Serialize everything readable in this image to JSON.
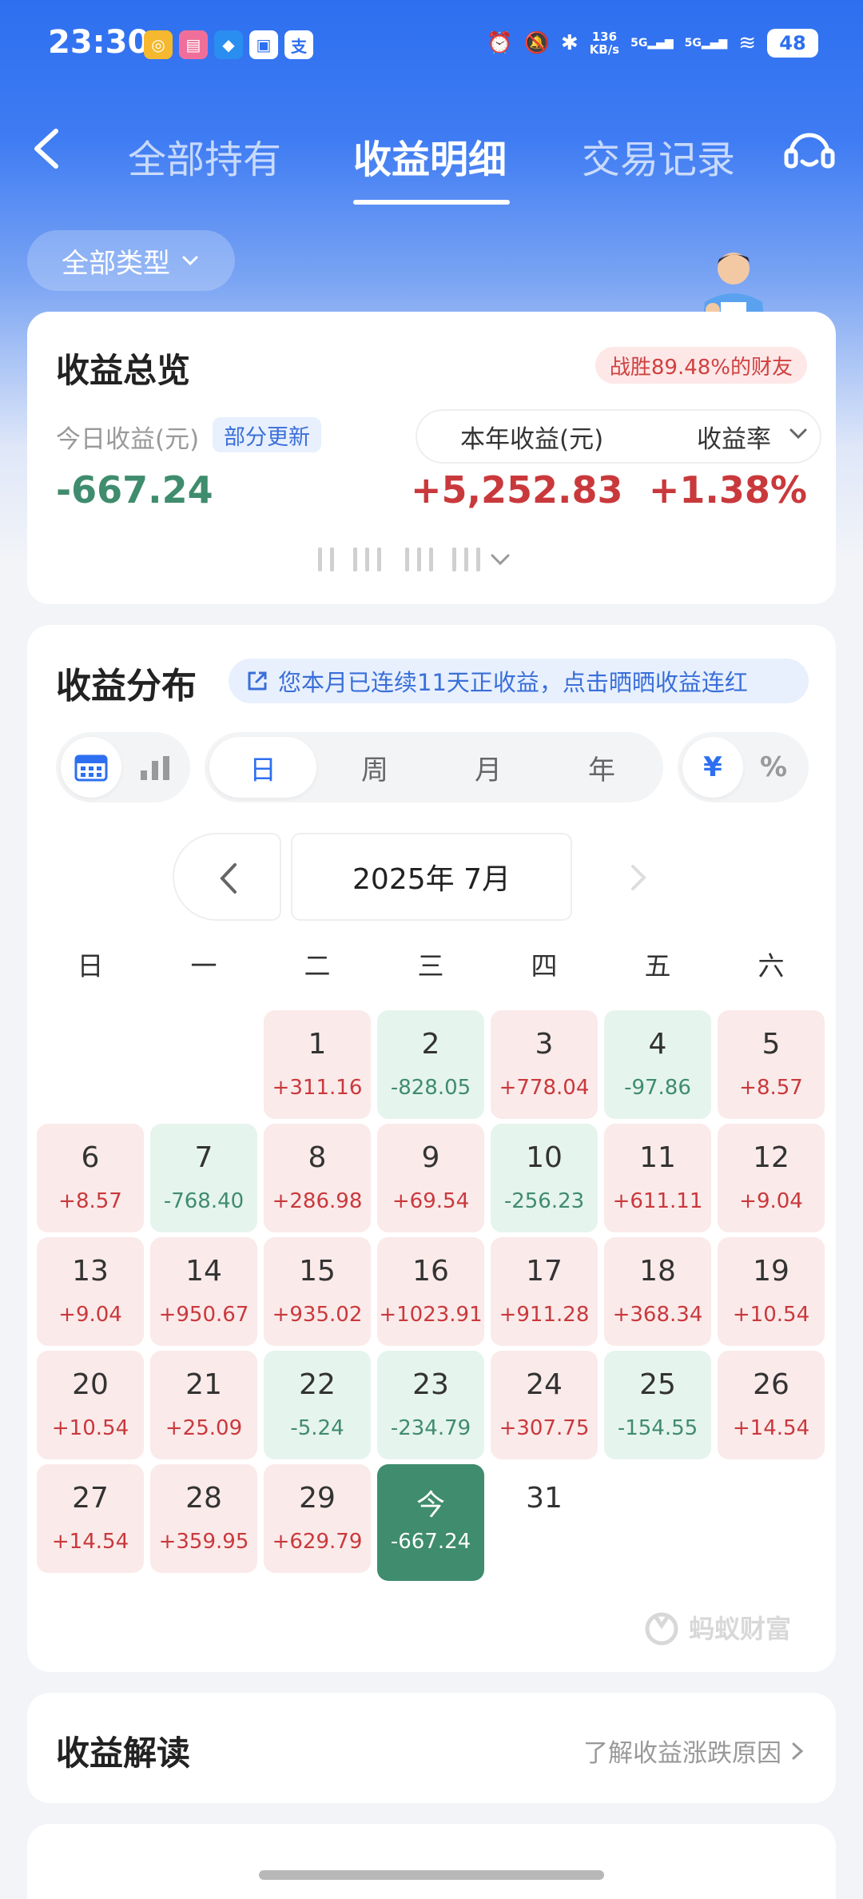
{
  "status_bar": {
    "time": "23:30",
    "net_speed_value": "136",
    "net_speed_unit": "KB/s",
    "signal1": "5G",
    "signal2": "5G",
    "battery": "48",
    "app_icons": [
      "app-icon-1",
      "bilibili-icon",
      "app-icon-3",
      "app-icon-4",
      "alipay-icon"
    ]
  },
  "nav": {
    "tabs": [
      "全部持有",
      "收益明细",
      "交易记录"
    ],
    "active_tab": 1
  },
  "filter": {
    "label": "全部类型"
  },
  "overview": {
    "title": "收益总览",
    "badge": "战胜89.48%的财友",
    "today_label": "今日收益(元)",
    "update_label": "部分更新",
    "today_value": "-667.24",
    "year_label": "本年收益(元)",
    "rate_label": "收益率",
    "year_value": "+5,252.83",
    "rate_value": "+1.38%"
  },
  "distribution": {
    "title": "收益分布",
    "tip": "您本月已连续11天正收益，点击晒晒收益连红",
    "periods": [
      "日",
      "周",
      "月",
      "年"
    ],
    "active_period": 0,
    "units": [
      "¥",
      "%"
    ],
    "active_unit": 0,
    "month_label": "2025年 7月",
    "weekdays": [
      "日",
      "一",
      "二",
      "三",
      "四",
      "五",
      "六"
    ],
    "brand": "蚂蚁财富",
    "days": [
      {
        "day": "1",
        "value": "+311.16",
        "type": "pos"
      },
      {
        "day": "2",
        "value": "-828.05",
        "type": "neg"
      },
      {
        "day": "3",
        "value": "+778.04",
        "type": "pos"
      },
      {
        "day": "4",
        "value": "-97.86",
        "type": "neg"
      },
      {
        "day": "5",
        "value": "+8.57",
        "type": "pos"
      },
      {
        "day": "6",
        "value": "+8.57",
        "type": "pos"
      },
      {
        "day": "7",
        "value": "-768.40",
        "type": "neg"
      },
      {
        "day": "8",
        "value": "+286.98",
        "type": "pos"
      },
      {
        "day": "9",
        "value": "+69.54",
        "type": "pos"
      },
      {
        "day": "10",
        "value": "-256.23",
        "type": "neg"
      },
      {
        "day": "11",
        "value": "+611.11",
        "type": "pos"
      },
      {
        "day": "12",
        "value": "+9.04",
        "type": "pos"
      },
      {
        "day": "13",
        "value": "+9.04",
        "type": "pos"
      },
      {
        "day": "14",
        "value": "+950.67",
        "type": "pos"
      },
      {
        "day": "15",
        "value": "+935.02",
        "type": "pos"
      },
      {
        "day": "16",
        "value": "+1023.91",
        "type": "pos"
      },
      {
        "day": "17",
        "value": "+911.28",
        "type": "pos"
      },
      {
        "day": "18",
        "value": "+368.34",
        "type": "pos"
      },
      {
        "day": "19",
        "value": "+10.54",
        "type": "pos"
      },
      {
        "day": "20",
        "value": "+10.54",
        "type": "pos"
      },
      {
        "day": "21",
        "value": "+25.09",
        "type": "pos"
      },
      {
        "day": "22",
        "value": "-5.24",
        "type": "neg"
      },
      {
        "day": "23",
        "value": "-234.79",
        "type": "neg"
      },
      {
        "day": "24",
        "value": "+307.75",
        "type": "pos"
      },
      {
        "day": "25",
        "value": "-154.55",
        "type": "neg"
      },
      {
        "day": "26",
        "value": "+14.54",
        "type": "pos"
      },
      {
        "day": "27",
        "value": "+14.54",
        "type": "pos"
      },
      {
        "day": "28",
        "value": "+359.95",
        "type": "pos"
      },
      {
        "day": "29",
        "value": "+629.79",
        "type": "pos"
      },
      {
        "day": "今",
        "value": "-667.24",
        "type": "today"
      },
      {
        "day": "31",
        "value": "",
        "type": "none"
      }
    ]
  },
  "interpret": {
    "title": "收益解读",
    "link": "了解收益涨跌原因"
  },
  "colors": {
    "brand_blue": "#2d6ff0",
    "gain_red": "#c9393c",
    "loss_green": "#3f8c6e"
  }
}
